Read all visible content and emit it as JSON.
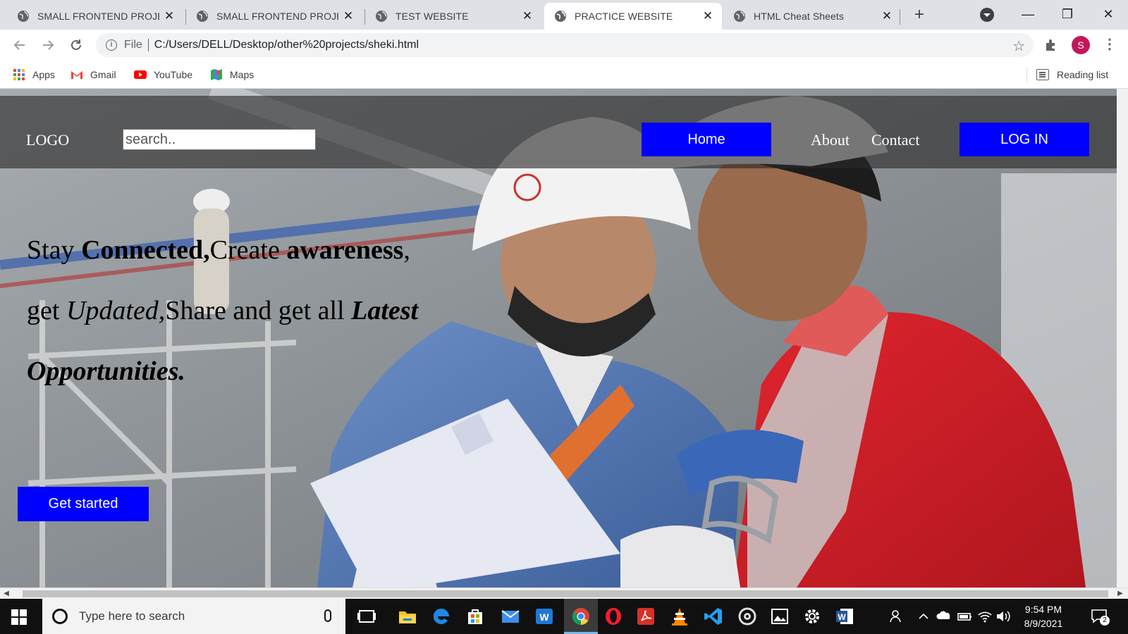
{
  "browser": {
    "tabs": [
      {
        "title": "SMALL FRONTEND PROJECTS",
        "active": false
      },
      {
        "title": "SMALL FRONTEND PROJECTS",
        "active": false
      },
      {
        "title": "TEST WEBSITE",
        "active": false
      },
      {
        "title": "PRACTICE WEBSITE",
        "active": true
      },
      {
        "title": "HTML Cheat Sheets",
        "active": false
      }
    ],
    "omnibox": {
      "scheme": "File",
      "url": "C:/Users/DELL/Desktop/other%20projects/sheki.html"
    },
    "profile_initial": "S",
    "bookmarks": [
      {
        "label": "Apps",
        "icon": "apps-grid-icon"
      },
      {
        "label": "Gmail",
        "icon": "gmail-icon"
      },
      {
        "label": "YouTube",
        "icon": "youtube-icon"
      },
      {
        "label": "Maps",
        "icon": "maps-icon"
      }
    ],
    "reading_list": "Reading list"
  },
  "site": {
    "logo": "LOGO",
    "search_placeholder": "search..",
    "nav": {
      "home": "Home",
      "about": "About",
      "contact": "Contact",
      "login": "LOG IN"
    },
    "headline": {
      "p1": "Stay ",
      "b1": "Connected,",
      "p2": "Create ",
      "b2": "awareness",
      "p3": ", get ",
      "i1": "Updated,",
      "p4": "Share and get all ",
      "bi1": "Latest Opportunities."
    },
    "cta": "Get started",
    "colors": {
      "button": "#0000ff",
      "nav_overlay": "rgba(40,40,40,0.62)"
    }
  },
  "taskbar": {
    "search_placeholder": "Type here to search",
    "time": "9:54 PM",
    "date": "8/9/2021",
    "notification_count": "2"
  }
}
